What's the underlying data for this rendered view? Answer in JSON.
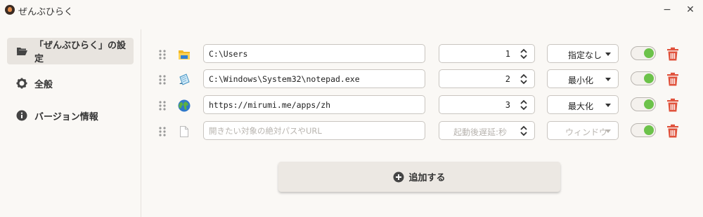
{
  "app": {
    "title": "ぜんぶひらく",
    "minimize_label": "−",
    "close_label": "✕"
  },
  "sidebar": {
    "items": [
      {
        "label": "「ぜんぶひらく」の設定",
        "icon": "folder-open-icon",
        "active": true
      },
      {
        "label": "全般",
        "icon": "gear-icon",
        "active": false
      },
      {
        "label": "バージョン情報",
        "icon": "info-icon",
        "active": false
      }
    ]
  },
  "rows": [
    {
      "path": "C:\\Users",
      "delay": "1",
      "window": "指定なし",
      "enabled": true,
      "icon": "folder-icon"
    },
    {
      "path": "C:\\Windows\\System32\\notepad.exe",
      "delay": "2",
      "window": "最小化",
      "enabled": true,
      "icon": "notepad-icon"
    },
    {
      "path": "https://mirumi.me/apps/zh",
      "delay": "3",
      "window": "最大化",
      "enabled": true,
      "icon": "globe-icon"
    }
  ],
  "new_row": {
    "path_placeholder": "開きたい対象の絶対パスやURL",
    "delay_placeholder": "起動後遅延:秒",
    "window_placeholder": "ウィンドウ",
    "enabled": true,
    "icon": "blank-file-icon"
  },
  "add_button": {
    "label": "追加する",
    "icon": "plus-circle-icon"
  },
  "colors": {
    "background": "#faf8f5",
    "sidebar_active": "#e8e4df",
    "toggle_on": "#6cc24a",
    "delete": "#e0533d"
  }
}
